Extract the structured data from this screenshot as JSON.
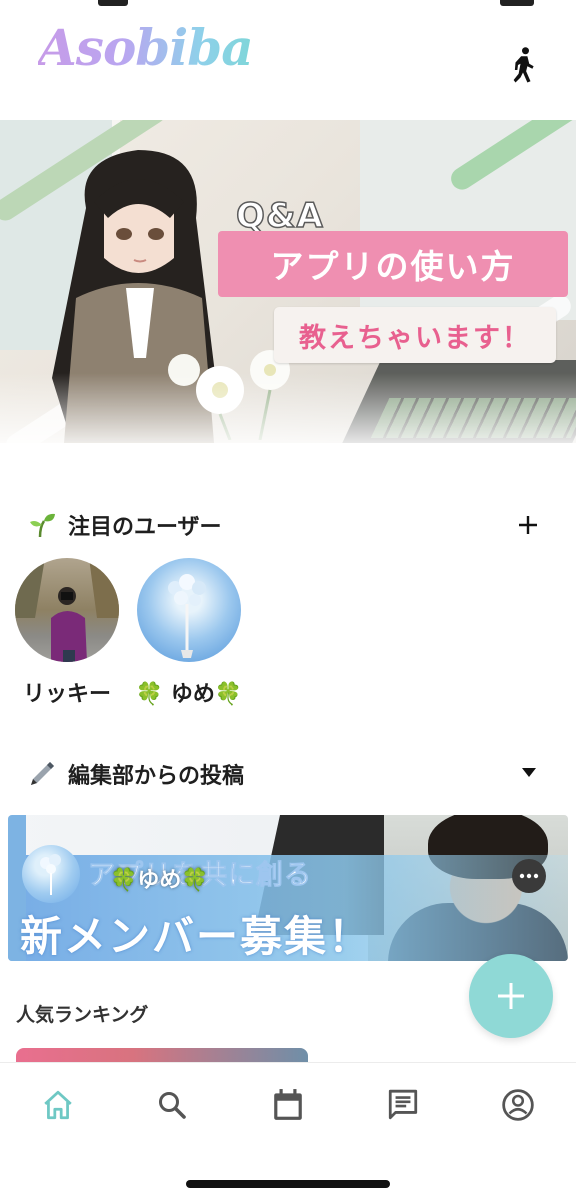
{
  "app": {
    "logo_text": "Asobiba",
    "brand_teal": "#8fd9d6",
    "brand_pink": "#ef8fb1"
  },
  "header": {
    "activity_icon": "walking-person-icon"
  },
  "banner": {
    "qa_text": "Q&A",
    "title": "アプリの使い方",
    "subtitle": "教えちゃいます！"
  },
  "featured_users": {
    "title": "注目のユーザー",
    "icon": "sprout-icon",
    "add_icon": "plus-icon",
    "users": [
      {
        "name": "リッキー"
      },
      {
        "name": "🍀 ゆめ🍀"
      }
    ]
  },
  "editorial": {
    "title": "編集部からの投稿",
    "icon": "pen-icon",
    "toggle_icon": "caret-down-icon",
    "post": {
      "author": "🍀ゆめ🍀",
      "tagline": "アプリを共に創る",
      "headline": "新メンバー募集！"
    }
  },
  "ranking": {
    "title": "人気ランキング"
  },
  "fab": {
    "icon": "plus-icon"
  },
  "bottom_nav": [
    {
      "name": "home",
      "icon": "home-icon",
      "active": true
    },
    {
      "name": "search",
      "icon": "search-icon",
      "active": false
    },
    {
      "name": "calendar",
      "icon": "calendar-icon",
      "active": false
    },
    {
      "name": "messages",
      "icon": "message-icon",
      "active": false
    },
    {
      "name": "profile",
      "icon": "account-icon",
      "active": false
    }
  ]
}
